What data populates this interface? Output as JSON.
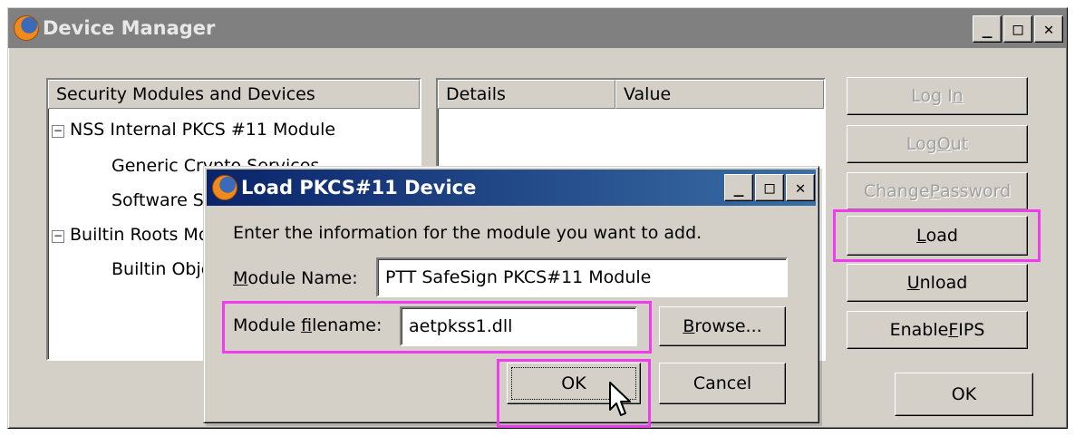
{
  "main_window": {
    "title": "Device Manager",
    "controls": {
      "minimize": "_",
      "maximize": "□",
      "close": "✕"
    }
  },
  "modules_pane": {
    "header": "Security Modules and Devices",
    "tree": [
      {
        "label": "NSS Internal PKCS #11 Module",
        "level": 0,
        "expander": "−"
      },
      {
        "label": "Generic Crypto Services",
        "level": 1
      },
      {
        "label": "Software Security Device",
        "level": 1
      },
      {
        "label": "Builtin Roots Module",
        "level": 0,
        "expander": "−"
      },
      {
        "label": "Builtin Object Token",
        "level": 1
      }
    ]
  },
  "details_pane": {
    "col_details": "Details",
    "col_value": "Value"
  },
  "side_buttons": {
    "log_in": {
      "pre": "Log I",
      "key": "n",
      "post": ""
    },
    "log_out": {
      "pre": "Log ",
      "key": "O",
      "post": "ut"
    },
    "change_password": {
      "pre": "Change ",
      "key": "P",
      "post": "assword"
    },
    "load": {
      "pre": "",
      "key": "L",
      "post": "oad"
    },
    "unload": {
      "pre": "",
      "key": "U",
      "post": "nload"
    },
    "enable_fips": {
      "pre": "Enable ",
      "key": "F",
      "post": "IPS"
    },
    "ok": "OK"
  },
  "dialog": {
    "title": "Load PKCS#11 Device",
    "instruction": "Enter the information for the module you want to add.",
    "module_name_label": {
      "pre": "",
      "key": "M",
      "post": "odule Name:"
    },
    "module_name_value": "PTT SafeSign PKCS#11 Module",
    "module_filename_label": {
      "pre": "Module ",
      "key": "f",
      "post": "ilename:"
    },
    "module_filename_value": "aetpkss1.dll",
    "browse": {
      "pre": "",
      "key": "B",
      "post": "rowse..."
    },
    "ok": "OK",
    "cancel": "Cancel"
  },
  "highlight_color": "#ef3cef"
}
